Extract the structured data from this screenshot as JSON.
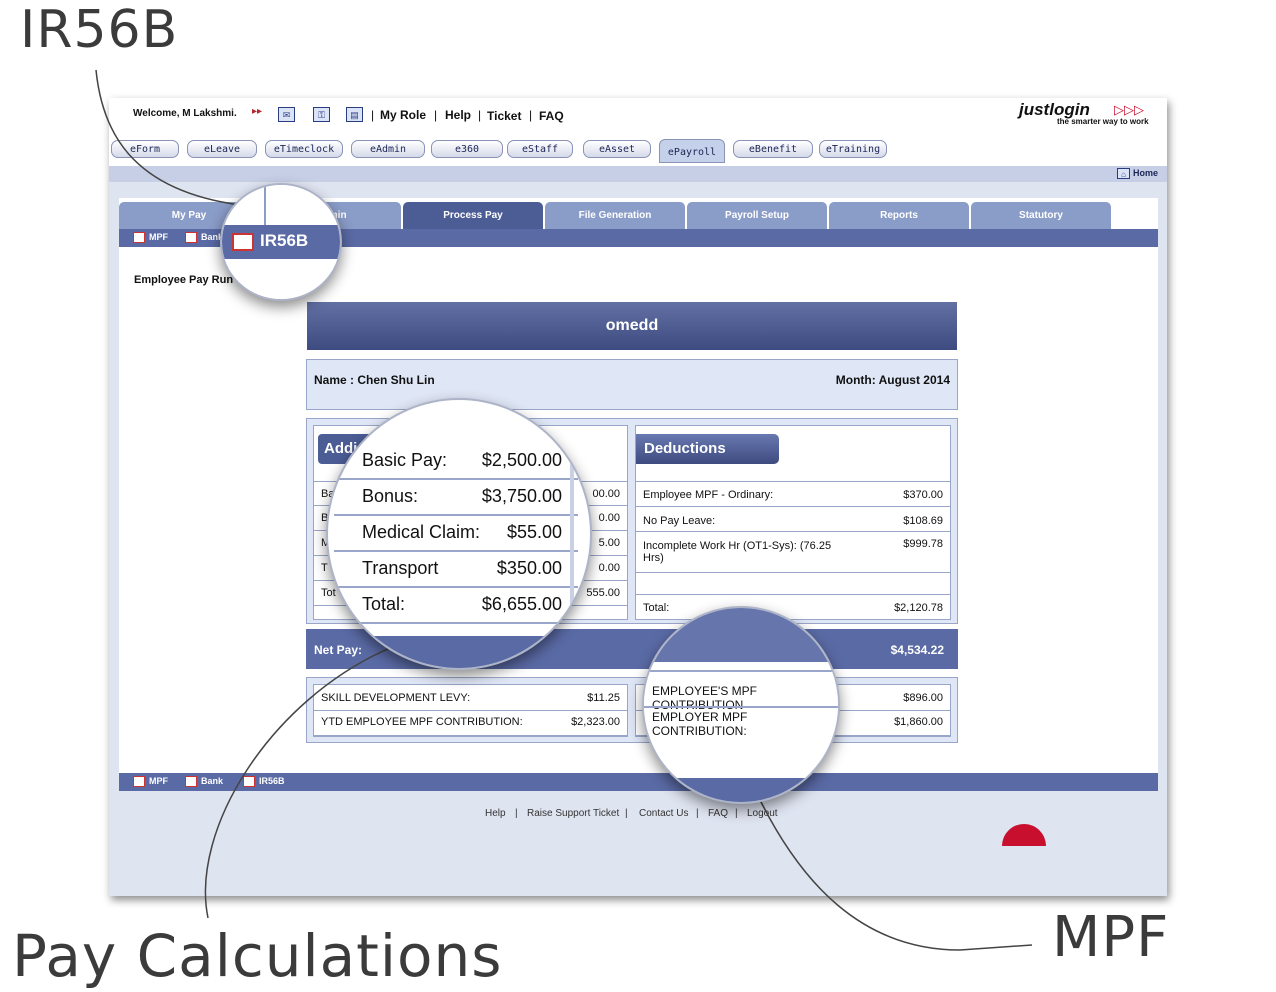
{
  "callouts": {
    "ir56b": "IR56B",
    "pay_calculations": "Pay Calculations",
    "mpf": "MPF"
  },
  "topbar": {
    "welcome": "Welcome, M Lakshmi.",
    "links": [
      "My Role",
      "Help",
      "Ticket",
      "FAQ"
    ],
    "logo_main": "justlogin",
    "logo_arrows": "▷▷▷",
    "tagline": "the smarter way to work"
  },
  "modules": [
    "eForm",
    "eLeave",
    "eTimeclock",
    "eAdmin",
    "e360",
    "eStaff",
    "eAsset",
    "ePayroll",
    "eBenefit",
    "eTraining"
  ],
  "home_label": "Home",
  "tabs": [
    "My Pay",
    "Admin",
    "Process Pay",
    "File Generation",
    "Payroll Setup",
    "Reports",
    "Statutory"
  ],
  "sublinks": [
    "MPF",
    "Bank",
    "IR56B"
  ],
  "page_title": "Employee Pay Run",
  "company": "omedd",
  "employee": {
    "name": "Name : Chen Shu Lin",
    "month": "Month: August 2014"
  },
  "additions": {
    "heading": "Addi",
    "peek_labels": [
      "Ba",
      "B",
      "M",
      "T",
      "Tot"
    ],
    "peek_values": [
      "00.00",
      "0.00",
      "5.00",
      "0.00",
      "555.00"
    ]
  },
  "deductions": {
    "heading": "Deductions",
    "rows": [
      {
        "label": "Employee MPF - Ordinary:",
        "value": "$370.00"
      },
      {
        "label": "No Pay Leave:",
        "value": "$108.69"
      },
      {
        "label": "Incomplete Work Hr (OT1-Sys): (76.25 Hrs)",
        "value": "$999.78"
      }
    ],
    "total_label": "Total:",
    "total_value": "$2,120.78"
  },
  "net_pay": {
    "label": "Net Pay:",
    "value": "$4,534.22"
  },
  "contributions_left": [
    {
      "label": "SKILL DEVELOPMENT LEVY:",
      "value": "$11.25"
    },
    {
      "label": "YTD EMPLOYEE MPF CONTRIBUTION:",
      "value": "$2,323.00"
    }
  ],
  "contributions_right_values": [
    "$896.00",
    "$1,860.00"
  ],
  "zoom_pay": [
    {
      "label": "Basic Pay:",
      "value": "$2,500.00"
    },
    {
      "label": "Bonus:",
      "value": "$3,750.00"
    },
    {
      "label": "Medical Claim:",
      "value": "$55.00"
    },
    {
      "label": "Transport",
      "value": "$350.00"
    },
    {
      "label": "Total:",
      "value": "$6,655.00"
    }
  ],
  "zoom_mpf": [
    "EMPLOYEE'S MPF CONTRIBUTION",
    "EMPLOYER MPF CONTRIBUTION:"
  ],
  "zoom_ir56b": "IR56B",
  "footer": [
    "Help",
    "Raise Support Ticket",
    "Contact Us",
    "FAQ",
    "Logout"
  ],
  "colors": {
    "navy": "#4c5d96",
    "tab": "#8a9cc8",
    "panel": "#dfe6f6",
    "brand_red": "#c8102e"
  }
}
